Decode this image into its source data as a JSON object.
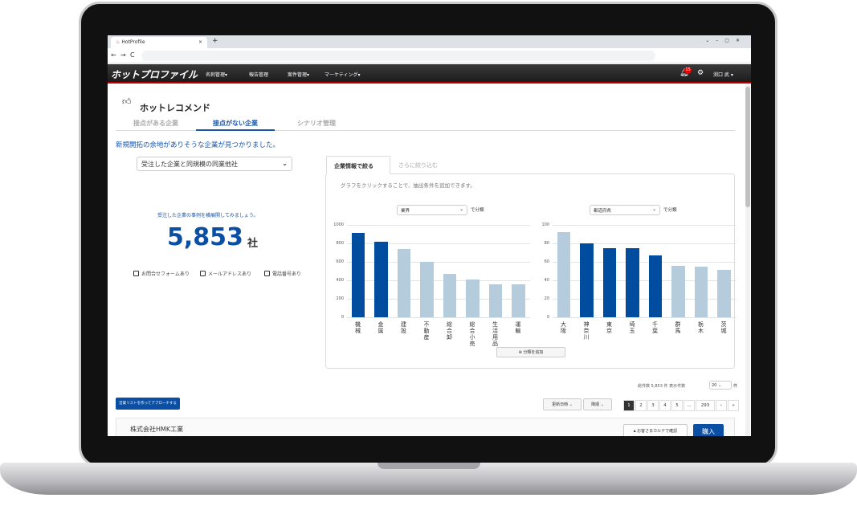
{
  "browser": {
    "tab_title": "HotProfile",
    "new_tab": "+",
    "window_controls": [
      "⌄",
      "–",
      "▢",
      "✕"
    ]
  },
  "nav": {
    "logo": "ホットプロファイル",
    "items": [
      "名刺管理▾",
      "報告管理",
      "案件管理▾",
      "マーケティング▾"
    ],
    "notification_count": "15",
    "user": "渕口 武 ▾"
  },
  "page": {
    "title": "ホットレコメンド",
    "tabs": [
      "接点がある企業",
      "接点がない企業",
      "シナリオ管理"
    ],
    "active_tab": 1,
    "message": "新規開拓の余地がありそうな企業が見つかりました。",
    "filter_select": "受注した企業と同規模の同業他社",
    "hint": "受注した企業の事例を横展開してみましょう。",
    "count": "5,853",
    "count_unit": "社",
    "checkboxes": [
      "お問合せフォームあり",
      "メールアドレスあり",
      "電話番号あり"
    ]
  },
  "panel": {
    "tabs": [
      "企業情報で絞る",
      "さらに絞り込む"
    ],
    "hint": "グラフをクリックすることで、抽出条件を追加できます。",
    "classify_suffix": "で分類",
    "add_button": "分類を追加"
  },
  "chart_data": [
    {
      "type": "bar",
      "select": "業界",
      "categories": [
        "機械",
        "金属",
        "建設",
        "不動産",
        "総合卸",
        "総合小売",
        "生活用品",
        "運輸"
      ],
      "values": [
        910,
        820,
        740,
        600,
        470,
        410,
        360,
        360
      ],
      "highlighted": [
        true,
        true,
        false,
        false,
        false,
        false,
        false,
        false
      ],
      "ylim": [
        0,
        1000
      ],
      "yticks": [
        "0",
        "200",
        "400",
        "600",
        "800",
        "1000"
      ],
      "grid": true
    },
    {
      "type": "bar",
      "select": "都道府県",
      "categories": [
        "大阪",
        "神奈川",
        "東京",
        "埼玉",
        "千葉",
        "群馬",
        "栃木",
        "茨城"
      ],
      "values": [
        92,
        80,
        75,
        75,
        67,
        56,
        55,
        51
      ],
      "highlighted": [
        false,
        true,
        true,
        true,
        true,
        false,
        false,
        false
      ],
      "ylim": [
        0,
        100
      ],
      "yticks": [
        "0",
        "20",
        "40",
        "60",
        "80",
        "100"
      ],
      "grid": true
    }
  ],
  "colors": {
    "highlight": "#004c9e",
    "normal": "#b5ccdd"
  },
  "list": {
    "action_button": "営業リストを作ってアプローチする",
    "total": "総件数 5,853 件 表示件数",
    "per_page": "20",
    "per_page_unit": "件",
    "sort": "更新日時",
    "order": "降順",
    "pages": [
      "1",
      "2",
      "3",
      "4",
      "5",
      "...",
      "293",
      "›",
      "»"
    ],
    "company": "株式会社HMK工業",
    "check_button": "お客さまカルテで確認",
    "buy_button": "購入"
  }
}
